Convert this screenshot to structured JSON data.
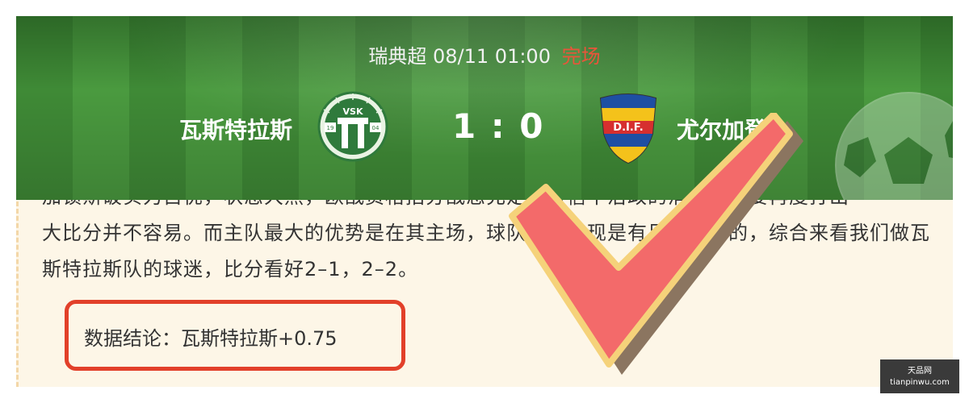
{
  "match": {
    "league": "瑞典超",
    "datetime": "08/11 01:00",
    "status": "完场",
    "home_team": "瓦斯特拉斯",
    "away_team": "尤尔加登",
    "score": "1 : 0",
    "home_logo_text": "VSK",
    "home_logo_year_left": "19",
    "home_logo_year_right": "04",
    "away_logo_text": "D.I.F.",
    "status_color": "#e8553a"
  },
  "article": {
    "lines": [
      "加锁斯破实力占优，状态大然，欧战资格招分战态充足，可信中治政的消耗，想要再度打出",
      "大比分并不容易。而主队最大的优势是在其主场，球队主场表现是有足够实力的，综合来看我们做瓦",
      "斯特拉斯队的球迷，比分看好2–1，2–2。"
    ],
    "conclusion": "数据结论：瓦斯特拉斯+0.75"
  },
  "watermark": {
    "line1": "天品网",
    "line2": "tianpinwu.com"
  },
  "icons": {
    "home_logo": "vasteras-sk-crest-icon",
    "away_logo": "djurgarden-crest-icon",
    "ball": "soccer-ball-icon",
    "check": "check-mark-icon"
  }
}
